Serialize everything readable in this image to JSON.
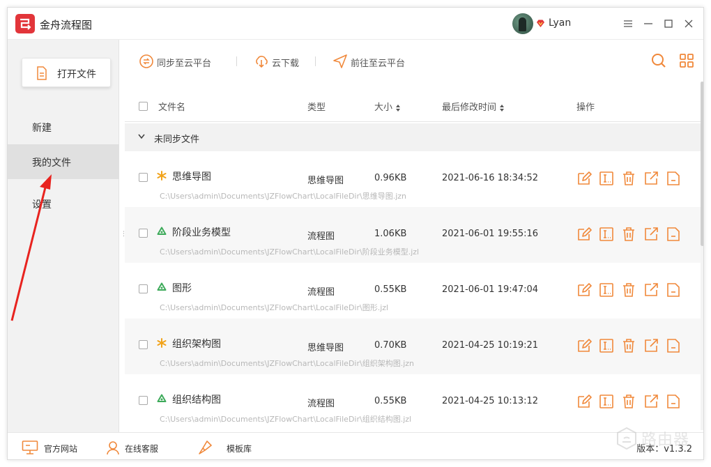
{
  "app": {
    "title": "金舟流程图",
    "user_name": "Lyan"
  },
  "sidebar": {
    "open_button": "打开文件",
    "items": [
      {
        "label": "新建",
        "active": false
      },
      {
        "label": "我的文件",
        "active": true
      },
      {
        "label": "设置",
        "active": false
      }
    ]
  },
  "toolbar": {
    "sync_label": "同步至云平台",
    "download_label": "云下载",
    "goto_label": "前往至云平台"
  },
  "table": {
    "headers": {
      "name": "文件名",
      "type": "类型",
      "size": "大小",
      "modified": "最后修改时间",
      "actions": "操作"
    },
    "group_label": "未同步文件",
    "rows": [
      {
        "name": "思维导图",
        "icon": "mindmap-star-icon",
        "path": "C:\\Users\\admin\\Documents\\JZFlowChart\\LocalFileDir\\思维导图.jzn",
        "type": "思维导图",
        "size": "0.96KB",
        "modified": "2021-06-16 18:34:52"
      },
      {
        "name": "阶段业务模型",
        "icon": "flowchart-recycle-icon",
        "path": "C:\\Users\\admin\\Documents\\JZFlowChart\\LocalFileDir\\阶段业务模型.jzl",
        "type": "流程图",
        "size": "1.06KB",
        "modified": "2021-06-01 19:55:16"
      },
      {
        "name": "图形",
        "icon": "flowchart-recycle-icon",
        "path": "C:\\Users\\admin\\Documents\\JZFlowChart\\LocalFileDir\\图形.jzl",
        "type": "流程图",
        "size": "0.55KB",
        "modified": "2021-06-01 19:47:04"
      },
      {
        "name": "组织架构图",
        "icon": "mindmap-star-icon",
        "path": "C:\\Users\\admin\\Documents\\JZFlowChart\\LocalFileDir\\组织架构图.jzn",
        "type": "思维导图",
        "size": "0.70KB",
        "modified": "2021-04-25 10:19:21"
      },
      {
        "name": "组织结构图",
        "icon": "flowchart-recycle-icon",
        "path": "C:\\Users\\admin\\Documents\\JZFlowChart\\LocalFileDir\\组织结构图.jzl",
        "type": "流程图",
        "size": "0.55KB",
        "modified": "2021-04-25 10:13:12"
      }
    ]
  },
  "footer": {
    "website": "官方网站",
    "support": "在线客服",
    "templates": "模板库",
    "version": "版本：v1.3.2"
  },
  "watermark": "路由器",
  "colors": {
    "accent": "#f0883a",
    "brand_red": "#e2353a",
    "annotation_red": "#e8231f",
    "flow_green": "#3daa5a"
  }
}
